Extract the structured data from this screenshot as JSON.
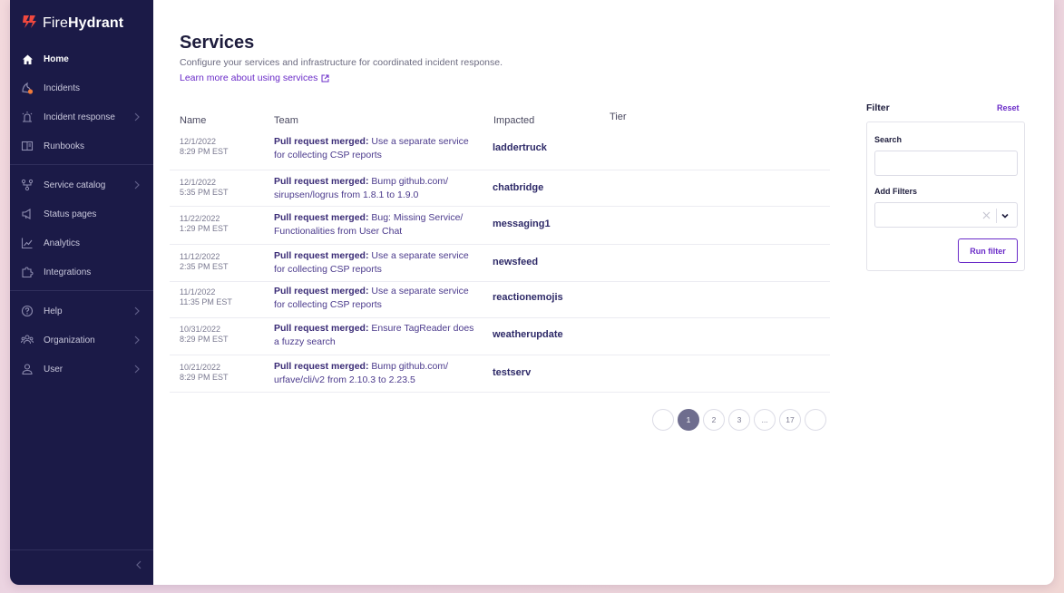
{
  "brand": {
    "name_prefix": "Fire",
    "name_bold": "Hydrant",
    "accent": "#f0483e"
  },
  "sidebar": {
    "items": [
      {
        "label": "Home",
        "icon": "home-icon"
      },
      {
        "label": "Incidents",
        "icon": "incidents-icon"
      },
      {
        "label": "Incident response",
        "icon": "siren-icon"
      },
      {
        "label": "Runbooks",
        "icon": "runbook-icon"
      },
      {
        "label": "Service catalog",
        "icon": "service-catalog-icon"
      },
      {
        "label": "Status pages",
        "icon": "megaphone-icon"
      },
      {
        "label": "Analytics",
        "icon": "chart-icon"
      },
      {
        "label": "Integrations",
        "icon": "puzzle-icon"
      },
      {
        "label": "Help",
        "icon": "help-icon"
      },
      {
        "label": "Organization",
        "icon": "organization-icon"
      },
      {
        "label": "User",
        "icon": "user-icon"
      }
    ]
  },
  "page": {
    "title": "Services",
    "subtitle": "Configure your services and infrastructure for coordinated incident response.",
    "learn_link": "Learn more about using services"
  },
  "table": {
    "headers": {
      "name": "Name",
      "team": "Team",
      "impacted": "Impacted",
      "tier": "Tier"
    },
    "rows": [
      {
        "date": "12/1/2022",
        "time": "8:29 PM EST",
        "event": "Pull request merged:",
        "desc_1": " Use a separate service",
        "desc_2": "for collecting CSP reports",
        "impacted": "laddertruck"
      },
      {
        "date": "12/1/2022",
        "time": "5:35 PM EST",
        "event": "Pull request merged:",
        "desc_1": " Bump github.com/",
        "desc_2": "sirupsen/logrus from 1.8.1 to 1.9.0",
        "impacted": "chatbridge"
      },
      {
        "date": "11/22/2022",
        "time": "1:29 PM EST",
        "event": "Pull request merged:",
        "desc_1": " Bug: Missing Service/",
        "desc_2": "Functionalities from User Chat",
        "impacted": "messaging1"
      },
      {
        "date": "11/12/2022",
        "time": "2:35 PM EST",
        "event": "Pull request merged:",
        "desc_1": " Use a separate service",
        "desc_2": "for collecting CSP reports",
        "impacted": "newsfeed"
      },
      {
        "date": "11/1/2022",
        "time": "11:35 PM EST",
        "event": "Pull request merged:",
        "desc_1": " Use a separate service",
        "desc_2": "for collecting CSP reports",
        "impacted": "reactionemojis"
      },
      {
        "date": "10/31/2022",
        "time": "8:29 PM EST",
        "event": "Pull request merged:",
        "desc_1": " Ensure TagReader does",
        "desc_2": "a fuzzy search",
        "impacted": "weatherupdate"
      },
      {
        "date": "10/21/2022",
        "time": "8:29 PM EST",
        "event": "Pull request merged:",
        "desc_1": " Bump github.com/",
        "desc_2": "urfave/cli/v2 from 2.10.3 to 2.23.5",
        "impacted": "testserv"
      }
    ]
  },
  "pagination": {
    "pages": [
      "1",
      "2",
      "3",
      "...",
      "17"
    ],
    "current": "1"
  },
  "filter": {
    "title": "Filter",
    "reset": "Reset",
    "search_label": "Search",
    "search_value": "",
    "add_filters_label": "Add Filters",
    "run_button": "Run filter"
  }
}
